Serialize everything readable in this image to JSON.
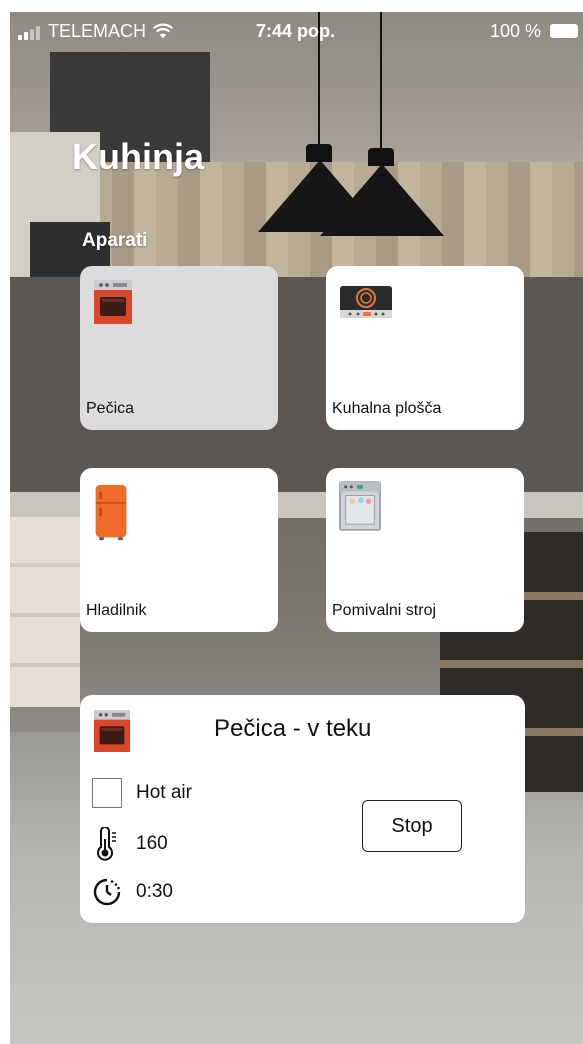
{
  "status_bar": {
    "carrier": "TELEMACH",
    "time": "7:44 pop.",
    "battery": "100 %"
  },
  "page_title": "Kuhinja",
  "section_title": "Aparati",
  "appliances": [
    {
      "label": "Pečica",
      "icon": "oven-icon",
      "selected": true
    },
    {
      "label": "Kuhalna plošča",
      "icon": "cooktop-icon",
      "selected": false
    },
    {
      "label": "Hladilnik",
      "icon": "fridge-icon",
      "selected": false
    },
    {
      "label": "Pomivalni stroj",
      "icon": "dishwasher-icon",
      "selected": false
    }
  ],
  "active_program": {
    "title": "Pečica - v teku",
    "mode": "Hot air",
    "mode_checked": false,
    "temperature": "160",
    "duration": "0:30",
    "stop_label": "Stop"
  },
  "colors": {
    "oven": "#d9472b",
    "fridge": "#f06a2a",
    "tile_selected": "#dcdcdc",
    "tile": "#ffffff"
  }
}
